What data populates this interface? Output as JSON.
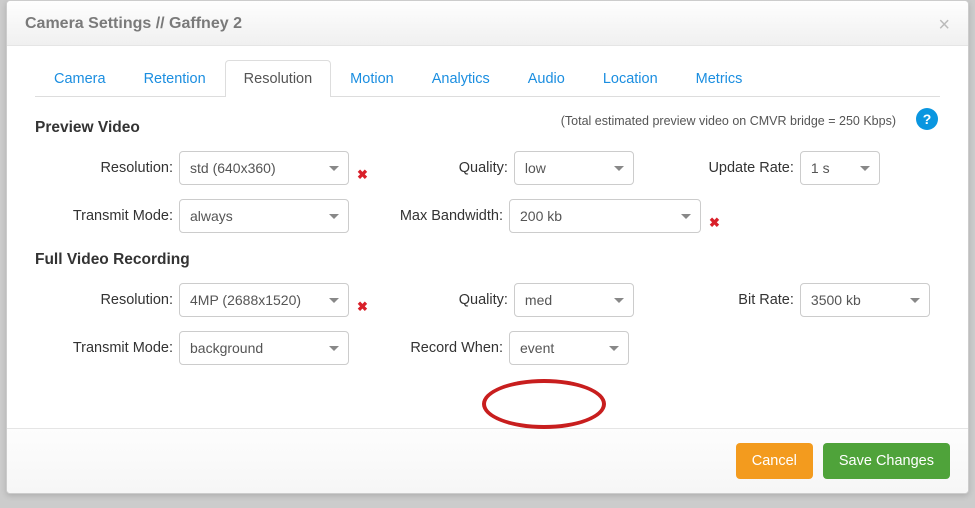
{
  "header": {
    "title": "Camera Settings // Gaffney 2"
  },
  "tabs": {
    "items": [
      {
        "label": "Camera"
      },
      {
        "label": "Retention"
      },
      {
        "label": "Resolution",
        "active": true
      },
      {
        "label": "Motion"
      },
      {
        "label": "Analytics"
      },
      {
        "label": "Audio"
      },
      {
        "label": "Location"
      },
      {
        "label": "Metrics"
      }
    ]
  },
  "info": {
    "estimate_text": "(Total estimated preview video on CMVR bridge = 250 Kbps)"
  },
  "help": {
    "glyph": "?"
  },
  "preview": {
    "title": "Preview Video",
    "resolution_label": "Resolution:",
    "resolution_value": "std (640x360)",
    "quality_label": "Quality:",
    "quality_value": "low",
    "update_rate_label": "Update Rate:",
    "update_rate_value": "1 s",
    "transmit_mode_label": "Transmit Mode:",
    "transmit_mode_value": "always",
    "max_bandwidth_label": "Max Bandwidth:",
    "max_bandwidth_value": "200 kb"
  },
  "full": {
    "title": "Full Video Recording",
    "resolution_label": "Resolution:",
    "resolution_value": "4MP (2688x1520)",
    "quality_label": "Quality:",
    "quality_value": "med",
    "bit_rate_label": "Bit Rate:",
    "bit_rate_value": "3500 kb",
    "transmit_mode_label": "Transmit Mode:",
    "transmit_mode_value": "background",
    "record_when_label": "Record When:",
    "record_when_value": "event"
  },
  "footer": {
    "cancel_label": "Cancel",
    "save_label": "Save Changes"
  },
  "marks": {
    "x_glyph": "✖"
  }
}
